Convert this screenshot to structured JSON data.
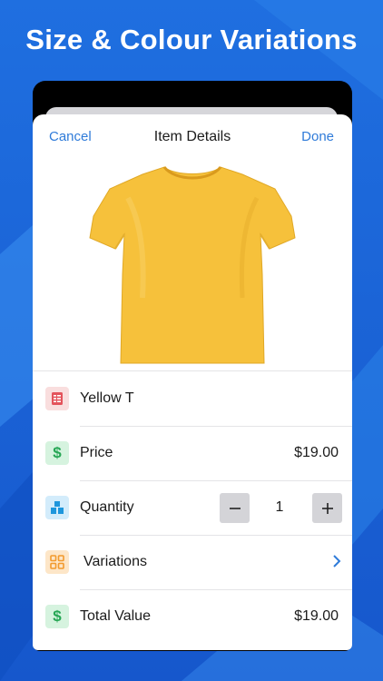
{
  "headline": "Size & Colour Variations",
  "colors": {
    "accent": "#2f7bd9",
    "background": "#1a63d8",
    "shirt": "#f6c13b"
  },
  "nav": {
    "cancel_label": "Cancel",
    "title": "Item Details",
    "done_label": "Done"
  },
  "item": {
    "image_icon": "yellow-tshirt",
    "name": "Yellow T"
  },
  "rows": {
    "price": {
      "label": "Price",
      "value": "$19.00",
      "icon": "dollar-icon"
    },
    "quantity": {
      "label": "Quantity",
      "value": "1",
      "icon": "boxes-icon",
      "minus": "−",
      "plus": "+"
    },
    "variations": {
      "label": "Variations",
      "icon": "grid-icon"
    },
    "total": {
      "label": "Total Value",
      "value": "$19.00",
      "icon": "dollar-icon"
    }
  }
}
